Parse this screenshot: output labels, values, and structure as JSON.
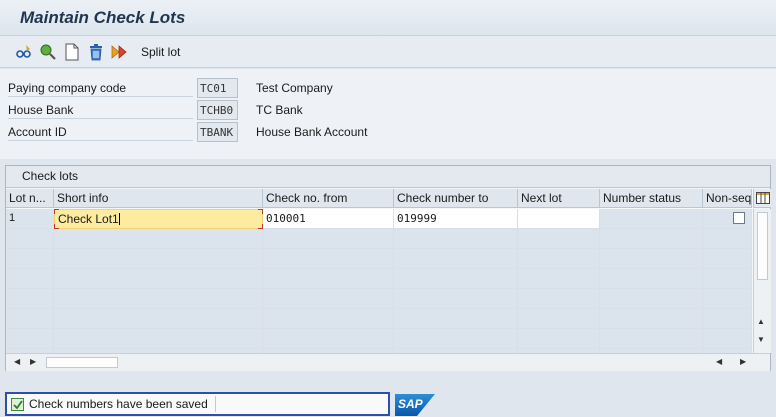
{
  "window": {
    "title": "Maintain Check Lots"
  },
  "toolbar": {
    "icons": [
      "glasses-edit-icon",
      "display-icon",
      "new-document-icon",
      "delete-icon",
      "next-icon"
    ],
    "split_lot_label": "Split lot"
  },
  "header": {
    "paying_company_code": {
      "label": "Paying company code",
      "value": "TC01",
      "description": "Test Company"
    },
    "house_bank": {
      "label": "House Bank",
      "value": "TCHB0",
      "description": "TC Bank"
    },
    "account_id": {
      "label": "Account ID",
      "value": "TBANK",
      "description": "House Bank Account"
    }
  },
  "check_lots": {
    "title": "Check lots",
    "columns": {
      "lot_number": "Lot n...",
      "short_info": "Short info",
      "check_no_from": "Check no. from",
      "check_number_to": "Check number to",
      "next_lot": "Next lot",
      "number_status": "Number status",
      "non_seq": "Non-seq"
    },
    "rows": [
      {
        "lot_number": "1",
        "short_info": "Check Lot1",
        "check_no_from": "010001",
        "check_number_to": "019999",
        "next_lot": "",
        "number_status": "",
        "non_seq": false
      }
    ]
  },
  "status": {
    "message": "Check numbers have been saved",
    "type": "success"
  },
  "branding": {
    "logo_text": "SAP"
  },
  "colors": {
    "accent": "#2d4fa7",
    "focus_cell": "#fdeba0",
    "title": "#1f3550"
  }
}
